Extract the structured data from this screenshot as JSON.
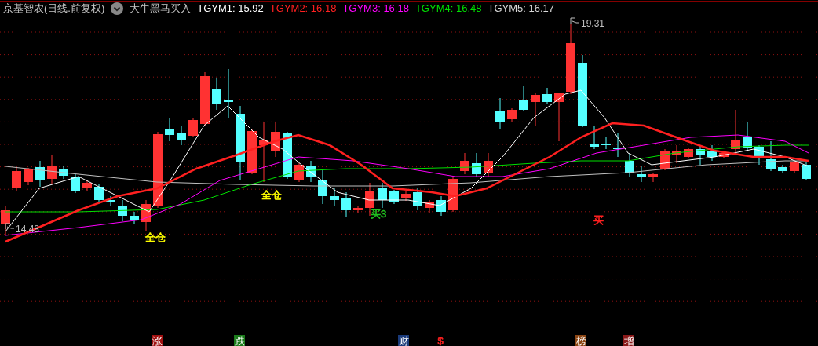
{
  "header": {
    "title": "京基智农(日线.前复权)",
    "formula": "大牛黑马买入",
    "indicators": [
      {
        "text": "TGYM1: 15.92",
        "color": "#ffffff"
      },
      {
        "text": "TGYM2: 16.18",
        "color": "#ff2020"
      },
      {
        "text": "TGYM3: 16.18",
        "color": "#ff00ff"
      },
      {
        "text": "TGYM4: 16.48",
        "color": "#00e000"
      },
      {
        "text": "TGYM5: 16.17",
        "color": "#d8d8d8"
      }
    ]
  },
  "price_marks": [
    {
      "kind": "high",
      "text": "19.31"
    },
    {
      "kind": "low",
      "text": "14.48"
    }
  ],
  "signals": [
    {
      "text": "全仓",
      "color": "#ffff00"
    },
    {
      "text": "全仓",
      "color": "#ffff00"
    },
    {
      "text": "买3",
      "color": "#20c020"
    },
    {
      "text": "买",
      "color": "#ff2020"
    }
  ],
  "badges": [
    {
      "kind": "filled",
      "text": "涨",
      "color": "#a01010"
    },
    {
      "kind": "filled",
      "text": "跌",
      "color": "#1a7a1a"
    },
    {
      "kind": "filled",
      "text": "财",
      "color": "#1a3a7a"
    },
    {
      "kind": "plain",
      "text": "$",
      "color": "#ff2020"
    },
    {
      "kind": "filled",
      "text": "榜",
      "color": "#8b4513"
    },
    {
      "kind": "filled",
      "text": "增",
      "color": "#8b1a1a"
    }
  ]
}
